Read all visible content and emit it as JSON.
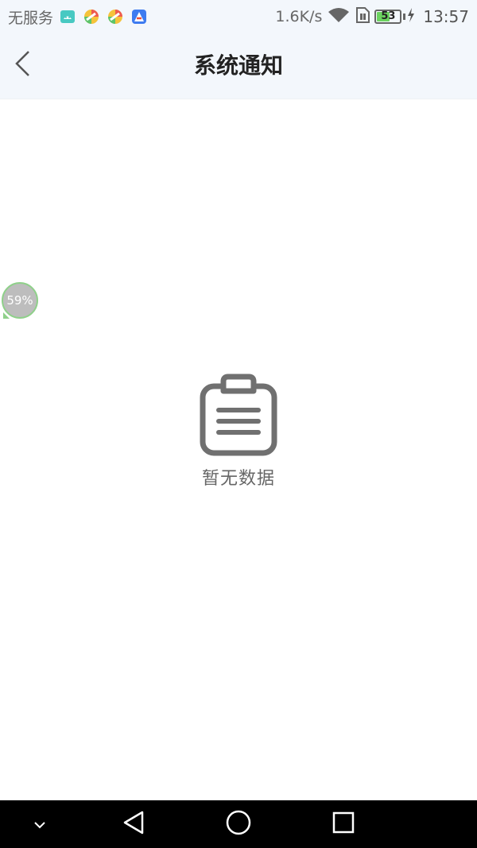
{
  "status_bar": {
    "carrier": "无服务",
    "net_speed": "1.6K/s",
    "battery_level": "53",
    "time": "13:57",
    "notification_icons": [
      "android-debug-icon",
      "app-pinwheel-icon",
      "app-pinwheel-icon",
      "maps-icon"
    ]
  },
  "header": {
    "title": "系统通知",
    "back_icon": "chevron-left-icon"
  },
  "floating_bubble": {
    "label": "59%"
  },
  "empty_state": {
    "icon": "clipboard-icon",
    "message": "暂无数据"
  },
  "system_nav": {
    "buttons": [
      "chevron-down-icon",
      "back-triangle-icon",
      "home-circle-icon",
      "recents-square-icon"
    ]
  },
  "colors": {
    "header_bg": "#f3f7fc",
    "empty_gray": "#707070",
    "battery_green": "#6bd35f",
    "nav_bar_bg": "#000000"
  }
}
